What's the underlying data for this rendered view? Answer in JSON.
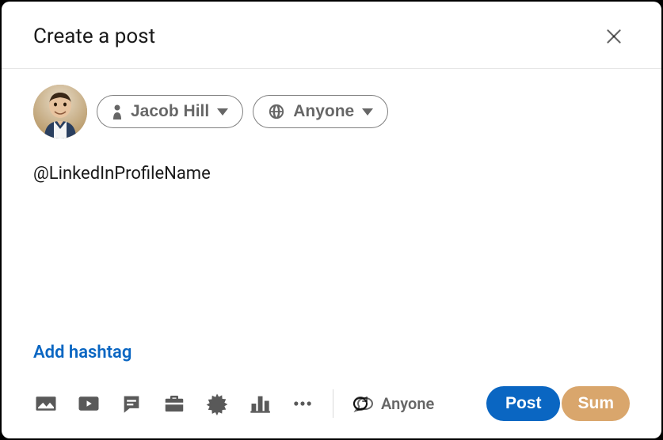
{
  "modal": {
    "title": "Create a post"
  },
  "author": {
    "name": "Jacob Hill"
  },
  "visibility": {
    "label": "Anyone"
  },
  "post": {
    "text": "@LinkedInProfileName"
  },
  "actions": {
    "add_hashtag": "Add hashtag",
    "comment_scope": "Anyone",
    "post": "Post",
    "sum": "Sum"
  }
}
